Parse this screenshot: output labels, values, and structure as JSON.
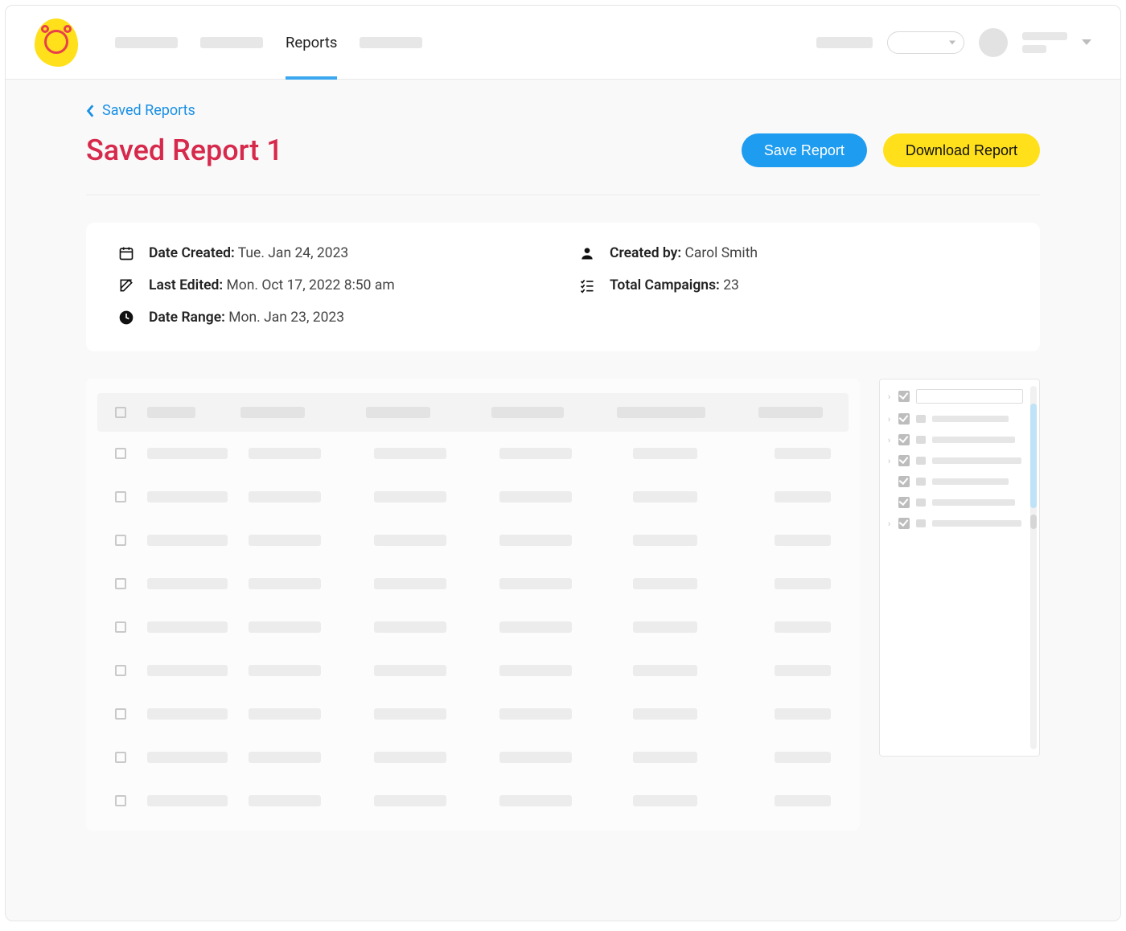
{
  "nav": {
    "active_tab": "Reports"
  },
  "breadcrumb": {
    "label": "Saved Reports"
  },
  "page": {
    "title": "Saved Report 1"
  },
  "actions": {
    "save": "Save Report",
    "download": "Download Report"
  },
  "meta": {
    "date_created_label": "Date Created:",
    "date_created_value": "Tue. Jan 24, 2023",
    "last_edited_label": "Last Edited:",
    "last_edited_value": "Mon. Oct 17, 2022 8:50 am",
    "date_range_label": "Date Range:",
    "date_range_value": "Mon. Jan 23, 2023",
    "created_by_label": "Created by:",
    "created_by_value": "Carol Smith",
    "total_campaigns_label": "Total Campaigns:",
    "total_campaigns_value": "23"
  }
}
